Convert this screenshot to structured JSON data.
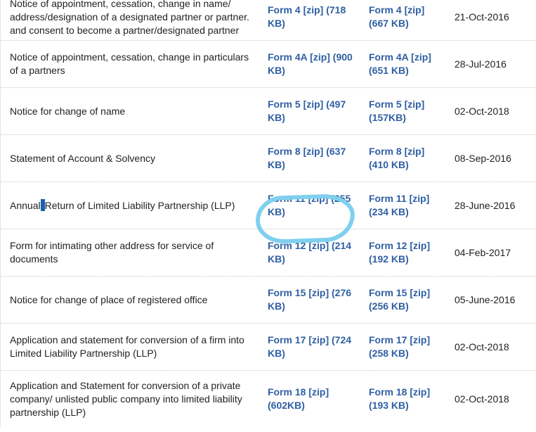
{
  "rows": [
    {
      "description": "Notice of appointment, cessation, change in name/ address/designation of a designated partner or partner. and consent to become a partner/designated partner",
      "form_link_1": "Form 4 [zip] (718 KB)",
      "form_link_2": "Form 4 [zip] (667 KB)",
      "date": "21-Oct-2016"
    },
    {
      "description": "Notice of appointment, cessation, change in particulars of a partners",
      "form_link_1": "Form 4A [zip] (900 KB)",
      "form_link_2": "Form 4A [zip] (651 KB)",
      "date": "28-Jul-2016"
    },
    {
      "description": "Notice for change of name",
      "form_link_1": "Form 5 [zip] (497 KB)",
      "form_link_2": "Form 5 [zip] (157KB)",
      "date": "02-Oct-2018"
    },
    {
      "description": "Statement of Account & Solvency",
      "form_link_1": "Form 8 [zip] (637 KB)",
      "form_link_2": "Form 8 [zip] (410 KB)",
      "date": "08-Sep-2016"
    },
    {
      "description_part1": "Annual",
      "description_part2": "Return of Limited Liability Partnership (LLP)",
      "form_link_1": "Form 11 [zip] (255 KB)",
      "form_link_2": "Form 11 [zip] (234 KB)",
      "date": "28-June-2016"
    },
    {
      "description": "Form for intimating other address for service of documents",
      "form_link_1": "Form 12 [zip] (214 KB)",
      "form_link_2": "Form 12 [zip] (192 KB)",
      "date": "04-Feb-2017"
    },
    {
      "description": "Notice for change of place of registered office",
      "form_link_1": "Form 15 [zip] (276 KB)",
      "form_link_2": "Form 15 [zip] (256 KB)",
      "date": "05-June-2016"
    },
    {
      "description": "Application and statement for conversion of a firm into Limited Liability Partnership (LLP)",
      "form_link_1": "Form 17 [zip] (724 KB)",
      "form_link_2": "Form 17 [zip] (258 KB)",
      "date": "02-Oct-2018"
    },
    {
      "description": "Application and Statement for conversion of a private company/ unlisted public company into limited liability partnership (LLP)",
      "form_link_1": "Form 18 [zip] (602KB)",
      "form_link_2": "Form 18 [zip] (193 KB)",
      "date": "02-Oct-2018"
    }
  ],
  "colors": {
    "link": "#2f5fa3",
    "text": "#222222",
    "highlight_circle": "#7fd0ee",
    "text_selection": "#1a5fb4"
  }
}
